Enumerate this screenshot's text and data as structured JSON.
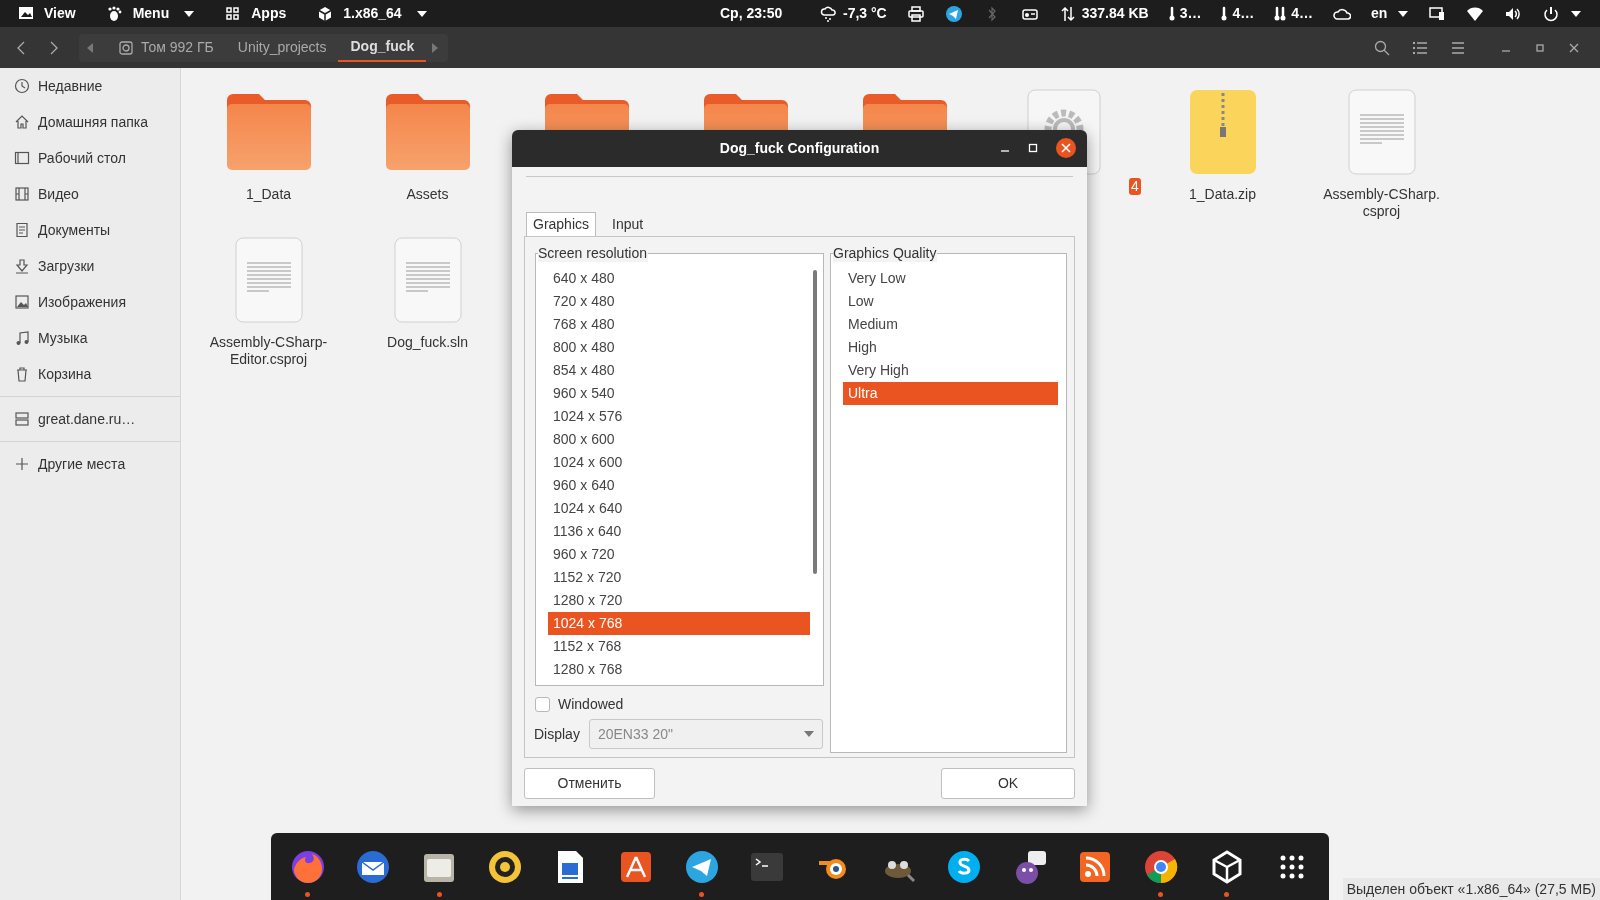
{
  "top_bar": {
    "left": [
      {
        "kind": "view",
        "label": "View",
        "dropdown": false
      },
      {
        "kind": "menu",
        "label": "Menu",
        "dropdown": true
      },
      {
        "kind": "apps",
        "label": "Apps",
        "dropdown": false
      },
      {
        "kind": "unity",
        "label": "1.x86_64",
        "dropdown": true
      }
    ],
    "clock": "Ср, 23:50",
    "indicators": [
      {
        "kind": "weather",
        "label": "-7,3 °C"
      },
      {
        "kind": "printer"
      },
      {
        "kind": "telegram"
      },
      {
        "kind": "bluetooth"
      },
      {
        "kind": "drive"
      },
      {
        "kind": "network",
        "label": "337.84 KB"
      },
      {
        "kind": "thermometer",
        "label": "3…"
      },
      {
        "kind": "thermometer",
        "label": "4…"
      },
      {
        "kind": "sensor",
        "label": "4…"
      },
      {
        "kind": "cloud"
      },
      {
        "kind": "keyboard",
        "label": "en",
        "dropdown": true
      },
      {
        "kind": "display"
      },
      {
        "kind": "wifi"
      },
      {
        "kind": "volume"
      },
      {
        "kind": "power",
        "dropdown": true
      }
    ]
  },
  "file_manager": {
    "path": [
      {
        "label": "Том 992 ГБ",
        "kind": "drive",
        "selected": false
      },
      {
        "label": "Unity_projects",
        "kind": "folder",
        "selected": false
      },
      {
        "label": "Dog_fuck",
        "kind": "folder",
        "selected": true
      }
    ],
    "sidebar": [
      {
        "kind": "recent",
        "label": "Недавние"
      },
      {
        "kind": "home",
        "label": "Домашняя папка"
      },
      {
        "kind": "desktop",
        "label": "Рабочий стол"
      },
      {
        "kind": "video",
        "label": "Видео"
      },
      {
        "kind": "documents",
        "label": "Документы"
      },
      {
        "kind": "downloads",
        "label": "Загрузки"
      },
      {
        "kind": "pictures",
        "label": "Изображения"
      },
      {
        "kind": "music",
        "label": "Музыка"
      },
      {
        "kind": "trash",
        "label": "Корзина"
      },
      {
        "kind": "server",
        "label": "great.dane.ru…"
      },
      {
        "kind": "other",
        "label": "Другие места"
      }
    ],
    "files": [
      {
        "kind": "folder",
        "lines": [
          "1_Data"
        ],
        "selected": false
      },
      {
        "kind": "folder",
        "lines": [
          "Assets"
        ],
        "selected": false
      },
      {
        "kind": "folder"
      },
      {
        "kind": "folder"
      },
      {
        "kind": "folder"
      },
      {
        "kind": "executable",
        "lines": [
          "4"
        ],
        "selected": true
      },
      {
        "kind": "archive",
        "lines": [
          "1_Data.zip"
        ],
        "selected": false
      },
      {
        "kind": "text",
        "lines": [
          "Assembly-CSharp.",
          "csproj"
        ],
        "selected": false
      },
      {
        "kind": "text",
        "lines": [
          "Assembly-CSharp-",
          "Editor.csproj"
        ],
        "selected": false
      },
      {
        "kind": "text",
        "lines": [
          "Dog_fuck.sln"
        ],
        "selected": false
      }
    ],
    "status": "Выделен объект «1.x86_64» (27,5 МБ)"
  },
  "dialog": {
    "title": "Dog_fuck Configuration",
    "tabs": [
      {
        "label": "Graphics",
        "selected": true
      },
      {
        "label": "Input",
        "selected": false
      }
    ],
    "resolution": {
      "title": "Screen resolution",
      "items": [
        {
          "label": "640 x 480",
          "selected": false
        },
        {
          "label": "720 x 480",
          "selected": false
        },
        {
          "label": "768 x 480",
          "selected": false
        },
        {
          "label": "800 x 480",
          "selected": false
        },
        {
          "label": "854 x 480",
          "selected": false
        },
        {
          "label": "960 x 540",
          "selected": false
        },
        {
          "label": "1024 x 576",
          "selected": false
        },
        {
          "label": "800 x 600",
          "selected": false
        },
        {
          "label": "1024 x 600",
          "selected": false
        },
        {
          "label": "960 x 640",
          "selected": false
        },
        {
          "label": "1024 x 640",
          "selected": false
        },
        {
          "label": "1136 x 640",
          "selected": false
        },
        {
          "label": "960 x 720",
          "selected": false
        },
        {
          "label": "1152 x 720",
          "selected": false
        },
        {
          "label": "1280 x 720",
          "selected": false
        },
        {
          "label": "1024 x 768",
          "selected": true
        },
        {
          "label": "1152 x 768",
          "selected": false
        },
        {
          "label": "1280 x 768",
          "selected": false
        }
      ]
    },
    "windowed": {
      "label": "Windowed",
      "checked": false
    },
    "display": {
      "label": "Display",
      "value": "20EN33 20\""
    },
    "quality": {
      "title": "Graphics Quality",
      "items": [
        {
          "label": "Very Low",
          "selected": false
        },
        {
          "label": "Low",
          "selected": false
        },
        {
          "label": "Medium",
          "selected": false
        },
        {
          "label": "High",
          "selected": false
        },
        {
          "label": "Very High",
          "selected": false
        },
        {
          "label": "Ultra",
          "selected": true
        }
      ]
    },
    "buttons": [
      {
        "label": "Отменить"
      },
      {
        "label": "OK"
      }
    ]
  },
  "dock": [
    {
      "kind": "browser",
      "running": true
    },
    {
      "kind": "mail",
      "running": false
    },
    {
      "kind": "files",
      "running": true
    },
    {
      "kind": "music",
      "running": false
    },
    {
      "kind": "writer",
      "running": false
    },
    {
      "kind": "store",
      "running": false
    },
    {
      "kind": "telegram",
      "running": true
    },
    {
      "kind": "terminal",
      "running": false
    },
    {
      "kind": "blender",
      "running": false
    },
    {
      "kind": "gimp",
      "running": false
    },
    {
      "kind": "skype",
      "running": false
    },
    {
      "kind": "chat",
      "running": false
    },
    {
      "kind": "rss",
      "running": false
    },
    {
      "kind": "chrome",
      "running": true
    },
    {
      "kind": "unity",
      "running": true
    },
    {
      "kind": "grid",
      "running": false
    }
  ]
}
